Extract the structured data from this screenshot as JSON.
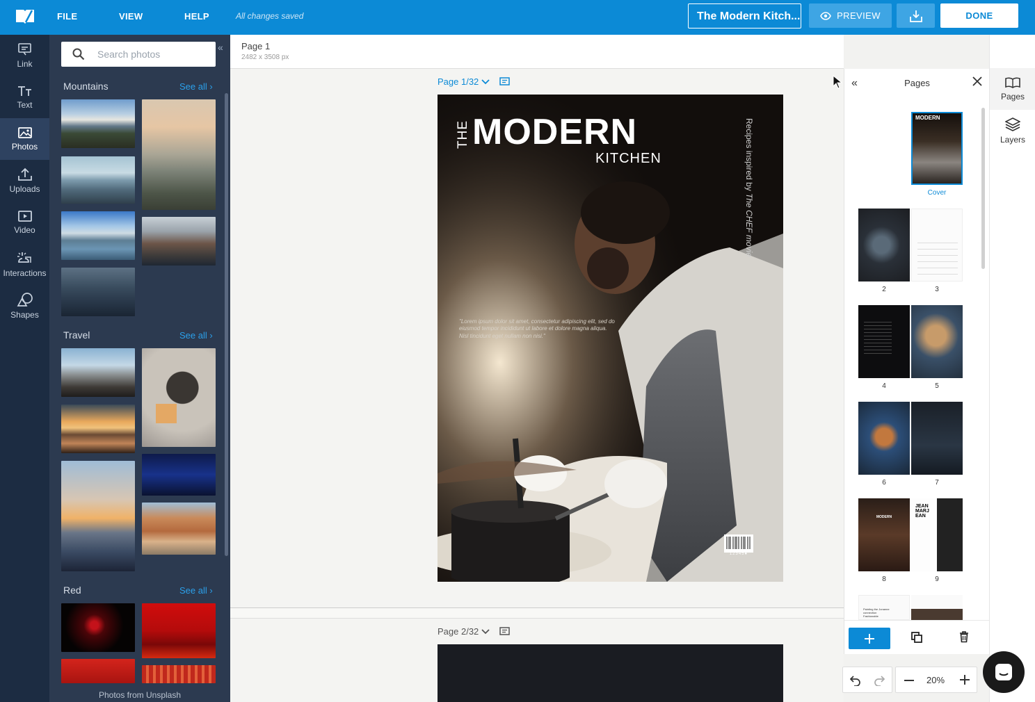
{
  "topbar": {
    "menu": [
      "FILE",
      "VIEW",
      "HELP"
    ],
    "status": "All changes saved",
    "doc_title": "The Modern Kitch...",
    "preview": "PREVIEW",
    "done": "DONE"
  },
  "tools": [
    {
      "label": "Link",
      "icon": "link-icon"
    },
    {
      "label": "Text",
      "icon": "text-icon"
    },
    {
      "label": "Photos",
      "icon": "photos-icon",
      "active": true
    },
    {
      "label": "Uploads",
      "icon": "upload-icon"
    },
    {
      "label": "Video",
      "icon": "video-icon"
    },
    {
      "label": "Interactions",
      "icon": "interactions-icon"
    },
    {
      "label": "Shapes",
      "icon": "shapes-icon"
    }
  ],
  "photos": {
    "search_placeholder": "Search photos",
    "sections": [
      {
        "title": "Mountains",
        "see_all": "See all"
      },
      {
        "title": "Travel",
        "see_all": "See all"
      },
      {
        "title": "Red",
        "see_all": "See all"
      }
    ],
    "footer": "Photos from Unsplash"
  },
  "page_info": {
    "name": "Page 1",
    "size": "2482 x 3508 px"
  },
  "canvas": {
    "page1_label": "Page 1/32",
    "page2_label": "Page 2/32",
    "cover": {
      "the": "THE",
      "modern": "MODERN",
      "kitchen": "KITCHEN",
      "side_text": "Recipes inspired by ",
      "side_italic": "The CHEF movie",
      "lorem": "\"Lorem ipsum dolor sit amet, consectetur adipiscing elit, sed do eiusmod tempor incididunt ut labore et dolore magna aliqua. Nisl tincidunt eget nullam non nisi.\"",
      "barcode_num": "12345●"
    }
  },
  "pages_panel": {
    "title": "Pages",
    "cover_label": "Cover",
    "thumb_text": {
      "modern": "MODERN",
      "jean": "JEAN MARJ EAN",
      "painting": "Painting the Jonanne connection Fashionable"
    },
    "page_numbers": [
      "2",
      "3",
      "4",
      "5",
      "6",
      "7",
      "8",
      "9"
    ]
  },
  "right_rail": [
    {
      "label": "Pages",
      "icon": "book-icon"
    },
    {
      "label": "Layers",
      "icon": "layers-icon"
    }
  ],
  "zoom": {
    "level": "20%"
  },
  "colors": {
    "accent": "#0c8ad6",
    "rail": "#1c2c42",
    "panel": "#2c3a50",
    "link": "#2ba0ea"
  }
}
